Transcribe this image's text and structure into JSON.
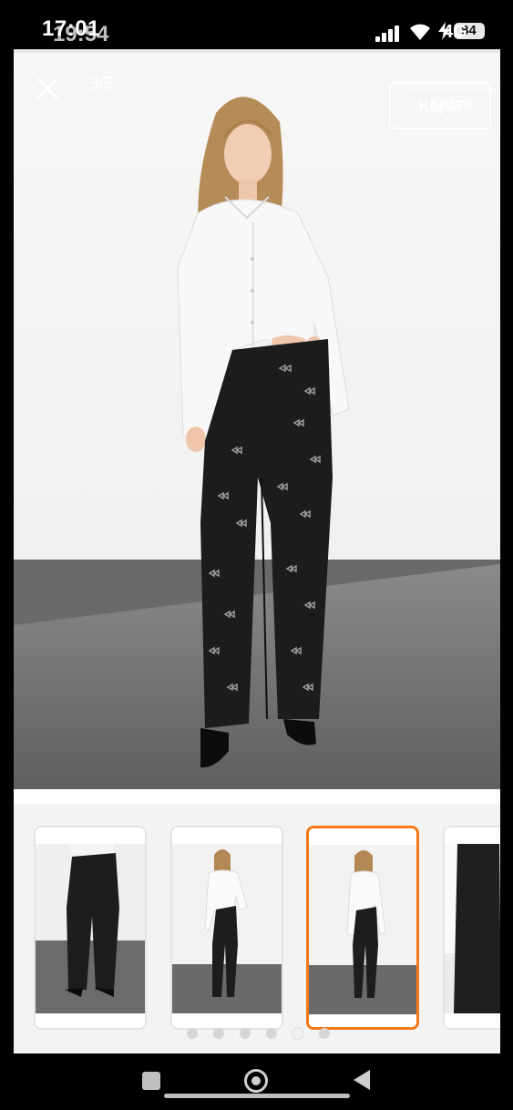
{
  "status_bar": {
    "time": "17:01",
    "time_overlay": "19:54",
    "network": "4G",
    "battery_level": "84"
  },
  "viewer": {
    "counter": "3/5",
    "close_button_label": "Kapat",
    "close_icon": "close-icon",
    "image": "product-photo-model-white-shirt-black-bow-jeans"
  },
  "thumbnails": [
    {
      "id": 1,
      "selected": false,
      "desc": "jeans-front-closeup"
    },
    {
      "id": 2,
      "selected": false,
      "desc": "full-body-pose-a"
    },
    {
      "id": 3,
      "selected": true,
      "desc": "full-body-pose-b"
    },
    {
      "id": 4,
      "selected": false,
      "desc": "jeans-side-closeup"
    }
  ],
  "pagination": {
    "count": 6,
    "active": 4
  },
  "colors": {
    "accent": "#f27a1a",
    "background": "#000000",
    "jeans": "#1c1c1d",
    "shirt": "#f8f8f8"
  },
  "nav": {
    "recents_icon": "square-icon",
    "home_icon": "home-circle-icon",
    "back_icon": "back-triangle-icon"
  }
}
